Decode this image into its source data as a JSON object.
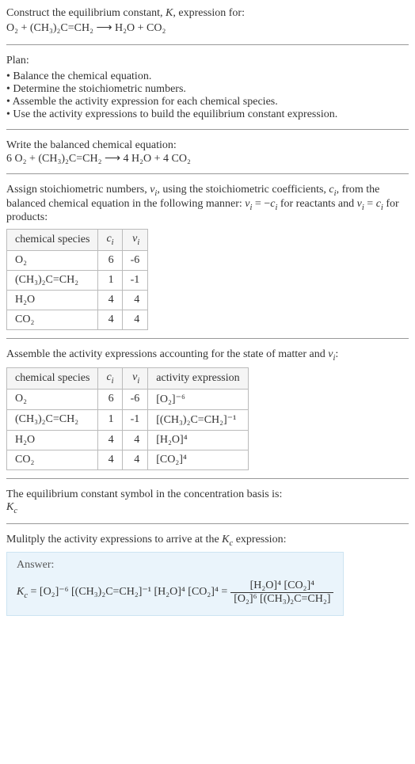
{
  "chart_data": [
    {
      "type": "table",
      "title": "Stoichiometric numbers",
      "columns": [
        "chemical species",
        "c_i",
        "ν_i"
      ],
      "rows": [
        {
          "species": "O2",
          "c": 6,
          "nu": -6
        },
        {
          "species": "(CH3)2C=CH2",
          "c": 1,
          "nu": -1
        },
        {
          "species": "H2O",
          "c": 4,
          "nu": 4
        },
        {
          "species": "CO2",
          "c": 4,
          "nu": 4
        }
      ]
    },
    {
      "type": "table",
      "title": "Activity expressions",
      "columns": [
        "chemical species",
        "c_i",
        "ν_i",
        "activity expression"
      ],
      "rows": [
        {
          "species": "O2",
          "c": 6,
          "nu": -6,
          "activity": "[O2]^-6"
        },
        {
          "species": "(CH3)2C=CH2",
          "c": 1,
          "nu": -1,
          "activity": "[(CH3)2C=CH2]^-1"
        },
        {
          "species": "H2O",
          "c": 4,
          "nu": 4,
          "activity": "[H2O]^4"
        },
        {
          "species": "CO2",
          "c": 4,
          "nu": 4,
          "activity": "[CO2]^4"
        }
      ]
    }
  ],
  "intro": {
    "line1": "Construct the equilibrium constant, K, expression for:",
    "equation": "O₂ + (CH₃)₂C=CH₂  ⟶  H₂O + CO₂"
  },
  "plan": {
    "heading": "Plan:",
    "items": [
      "Balance the chemical equation.",
      "Determine the stoichiometric numbers.",
      "Assemble the activity expression for each chemical species.",
      "Use the activity expressions to build the equilibrium constant expression."
    ]
  },
  "balanced": {
    "heading": "Write the balanced chemical equation:",
    "equation": "6 O₂ + (CH₃)₂C=CH₂  ⟶  4 H₂O + 4 CO₂"
  },
  "stoich": {
    "heading": "Assign stoichiometric numbers, νᵢ, using the stoichiometric coefficients, cᵢ, from the balanced chemical equation in the following manner: νᵢ = −cᵢ for reactants and νᵢ = cᵢ for products:",
    "cols": {
      "c0": "chemical species",
      "c1": "cᵢ",
      "c2": "νᵢ"
    },
    "rows": {
      "r0": {
        "sp": "O₂",
        "c": "6",
        "nu": "-6"
      },
      "r1": {
        "sp": "(CH₃)₂C=CH₂",
        "c": "1",
        "nu": "-1"
      },
      "r2": {
        "sp": "H₂O",
        "c": "4",
        "nu": "4"
      },
      "r3": {
        "sp": "CO₂",
        "c": "4",
        "nu": "4"
      }
    }
  },
  "activity": {
    "heading": "Assemble the activity expressions accounting for the state of matter and νᵢ:",
    "cols": {
      "c0": "chemical species",
      "c1": "cᵢ",
      "c2": "νᵢ",
      "c3": "activity expression"
    },
    "rows": {
      "r0": {
        "sp": "O₂",
        "c": "6",
        "nu": "-6",
        "a": "[O₂]⁻⁶"
      },
      "r1": {
        "sp": "(CH₃)₂C=CH₂",
        "c": "1",
        "nu": "-1",
        "a": "[(CH₃)₂C=CH₂]⁻¹"
      },
      "r2": {
        "sp": "H₂O",
        "c": "4",
        "nu": "4",
        "a": "[H₂O]⁴"
      },
      "r3": {
        "sp": "CO₂",
        "c": "4",
        "nu": "4",
        "a": "[CO₂]⁴"
      }
    }
  },
  "symbol": {
    "heading": "The equilibrium constant symbol in the concentration basis is:",
    "value": "K_c"
  },
  "multiply": {
    "heading": "Mulitply the activity expressions to arrive at the K_c expression:"
  },
  "answer": {
    "label": "Answer:",
    "lhs": "K_c = [O₂]⁻⁶ [(CH₃)₂C=CH₂]⁻¹ [H₂O]⁴ [CO₂]⁴ =",
    "frac_num": "[H₂O]⁴ [CO₂]⁴",
    "frac_den": "[O₂]⁶ [(CH₃)₂C=CH₂]"
  }
}
